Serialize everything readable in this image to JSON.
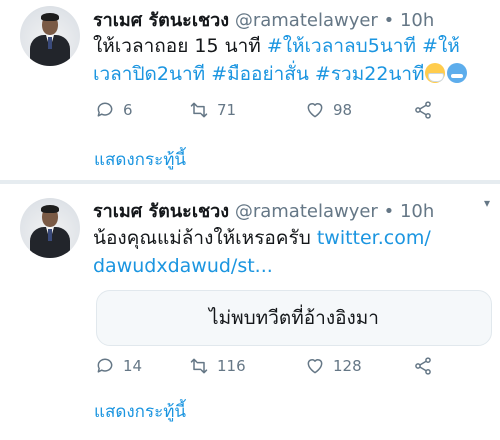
{
  "tweets": [
    {
      "name": "ราเมศ รัตนะเชวง",
      "handle": "@ramatelawyer",
      "dot": "•",
      "time": "10h",
      "text_line1_plain": "ให้เวลาถอย 15 นาที ",
      "text_line1_hashtag": "#ให้เวลาลบ5นาที",
      "text_line1_hashtag2": " #ให้",
      "text_line2_hashtag1": "เวลาปิด2นาที",
      "text_line2_hashtag2": "#มืออย่าสั่น",
      "text_line2_hashtag3": "#รวม22นาที",
      "emojis": [
        "face-with-medical-mask-icon",
        "cold-face-icon"
      ],
      "actions": {
        "replies": "6",
        "retweets": "71",
        "likes": "98"
      },
      "show_thread": "แสดงกระทู้นี้"
    },
    {
      "name": "ราเมศ รัตนะเชวง",
      "handle": "@ramatelawyer",
      "dot": "•",
      "time": "10h",
      "text_line1_plain": "น้องคุณแม่ล้างให้เหรอครับ ",
      "link_part1": "twitter.com/",
      "link_part2": "dawudxdawud/st...",
      "quote_unavailable": "ไม่พบทวีตที่อ้างอิงมา",
      "actions": {
        "replies": "14",
        "retweets": "116",
        "likes": "128"
      },
      "show_thread": "แสดงกระทู้นี้"
    }
  ],
  "colors": {
    "accent": "#1b95e0",
    "muted": "#657786",
    "divider": "#e6ecf0"
  }
}
